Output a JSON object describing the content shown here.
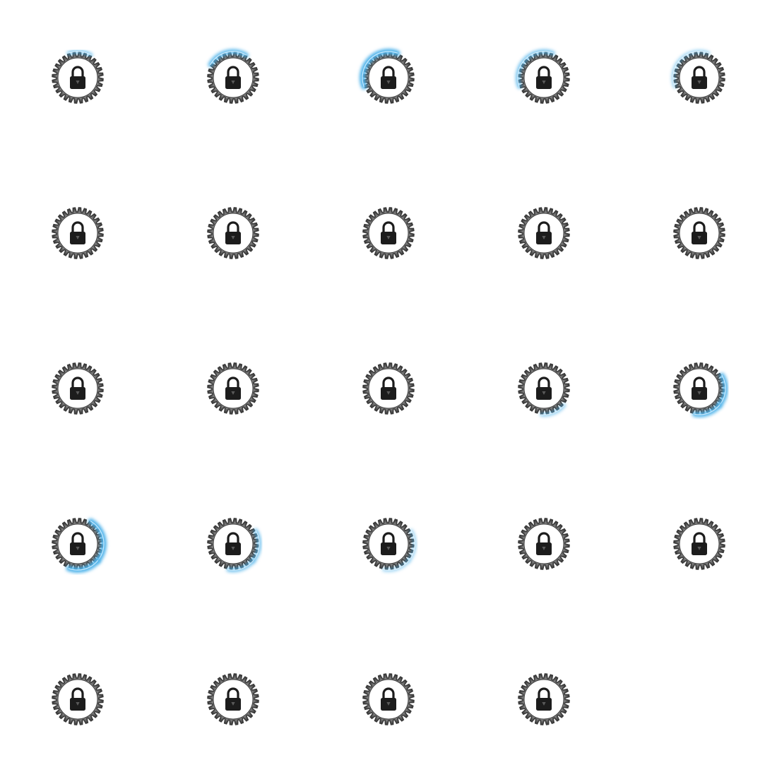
{
  "sprite_sheet": {
    "columns": 5,
    "rows": 5,
    "frame_count": 24,
    "icon": "padlock-in-gear-icon",
    "colors": {
      "background": "#ffffff",
      "gear_dark": "#3a3a3a",
      "gear_light": "#8a8a8a",
      "lock_body": "#1c1c1c",
      "glow": "#4fb3ea"
    },
    "frames": [
      {
        "glow": "top",
        "glow_strength": 0.5
      },
      {
        "glow": "top-left",
        "glow_strength": 0.8
      },
      {
        "glow": "left-upper",
        "glow_strength": 1.0
      },
      {
        "glow": "left-upper",
        "glow_strength": 0.6
      },
      {
        "glow": "left-upper",
        "glow_strength": 0.3
      },
      {
        "glow": "none",
        "glow_strength": 0
      },
      {
        "glow": "none",
        "glow_strength": 0
      },
      {
        "glow": "none",
        "glow_strength": 0
      },
      {
        "glow": "none",
        "glow_strength": 0
      },
      {
        "glow": "none",
        "glow_strength": 0
      },
      {
        "glow": "none",
        "glow_strength": 0
      },
      {
        "glow": "none",
        "glow_strength": 0
      },
      {
        "glow": "none",
        "glow_strength": 0
      },
      {
        "glow": "bottom-right",
        "glow_strength": 0.4
      },
      {
        "glow": "right",
        "glow_strength": 0.9
      },
      {
        "glow": "right-large",
        "glow_strength": 1.0
      },
      {
        "glow": "right",
        "glow_strength": 0.6
      },
      {
        "glow": "right",
        "glow_strength": 0.3
      },
      {
        "glow": "none",
        "glow_strength": 0
      },
      {
        "glow": "none",
        "glow_strength": 0
      },
      {
        "glow": "none",
        "glow_strength": 0
      },
      {
        "glow": "none",
        "glow_strength": 0
      },
      {
        "glow": "none",
        "glow_strength": 0
      },
      {
        "glow": "none",
        "glow_strength": 0
      }
    ]
  }
}
